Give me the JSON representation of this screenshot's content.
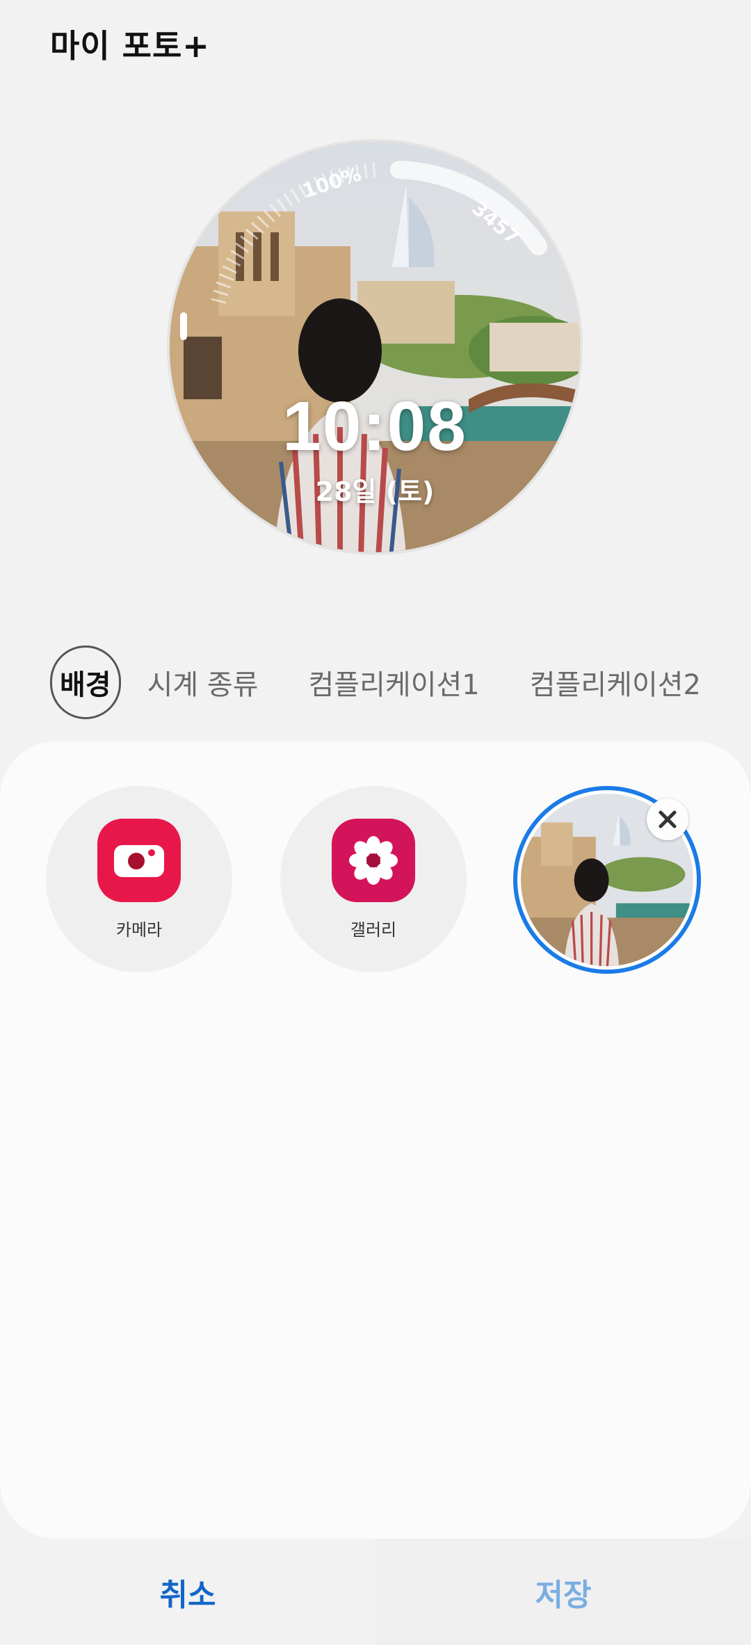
{
  "header": {
    "title": "마이 포토+"
  },
  "watch": {
    "time": "10:08",
    "date": "28일 (토)",
    "battery": "100%",
    "steps": "3457"
  },
  "tabs": [
    {
      "label": "배경",
      "selected": true
    },
    {
      "label": "시계 종류",
      "selected": false
    },
    {
      "label": "컴플리케이션1",
      "selected": false
    },
    {
      "label": "컴플리케이션2",
      "selected": false
    }
  ],
  "options": {
    "camera": {
      "label": "카메라",
      "icon": "camera-icon",
      "color": "#e8174a"
    },
    "gallery": {
      "label": "갤러리",
      "icon": "flower-icon",
      "color": "#d4145a"
    },
    "photo": {
      "selected": true,
      "border_color": "#1a7be6"
    }
  },
  "actions": {
    "cancel": "취소",
    "save": "저장"
  },
  "colors": {
    "accent": "#1466c8",
    "save_disabled": "#7aaee2"
  }
}
